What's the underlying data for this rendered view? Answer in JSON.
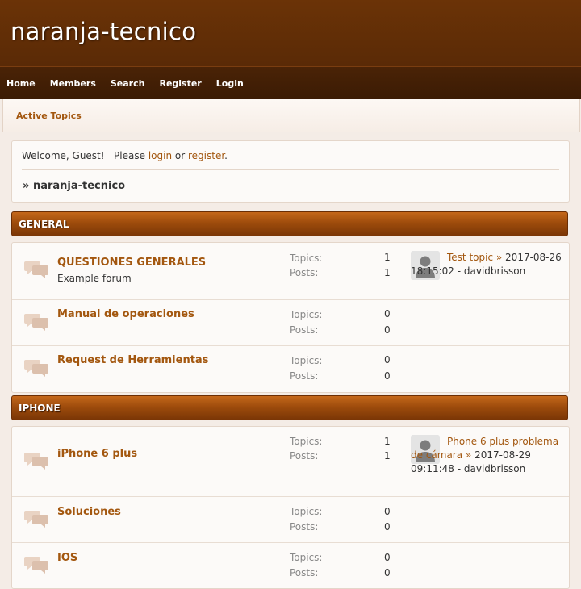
{
  "site": {
    "title": "naranja-tecnico"
  },
  "nav": {
    "items": [
      "Home",
      "Members",
      "Search",
      "Register",
      "Login"
    ]
  },
  "subnav": {
    "active_topics": "Active Topics"
  },
  "welcome": {
    "greeting": "Welcome, Guest!",
    "please": "Please",
    "login": "login",
    "or": "or",
    "register": "register",
    "period": ".",
    "breadcrumb_prefix": "»",
    "breadcrumb": "naranja-tecnico"
  },
  "labels": {
    "topics": "Topics:",
    "posts": "Posts:",
    "last_post_arrow": "»"
  },
  "categories": [
    {
      "name": "GENERAL",
      "forums": [
        {
          "name": "QUESTIONES GENERALES",
          "description": "Example forum",
          "topics": "1",
          "posts": "1",
          "last_post": {
            "title": "Test topic",
            "date": "2017-08-26 18:15:02 -",
            "author": "davidbrisson"
          }
        },
        {
          "name": "Manual de operaciones",
          "topics": "0",
          "posts": "0"
        },
        {
          "name": "Request de Herramientas",
          "topics": "0",
          "posts": "0"
        }
      ]
    },
    {
      "name": "IPHONE",
      "forums": [
        {
          "name": "iPhone 6 plus",
          "topics": "1",
          "posts": "1",
          "last_post": {
            "title": "Phone 6 plus problema de cámara",
            "date": "2017-08-29 09:11:48 -",
            "author": "davidbrisson"
          }
        },
        {
          "name": "Soluciones",
          "topics": "0",
          "posts": "0"
        },
        {
          "name": "IOS",
          "topics": "0",
          "posts": "0"
        }
      ]
    }
  ],
  "colors": {
    "header": "#6b3307",
    "navbar": "#3b1b04",
    "accent": "#a3570f",
    "category": "#9e4c0c"
  },
  "icons": {
    "forum": "speech-bubbles-icon",
    "avatar": "default-avatar-icon"
  }
}
